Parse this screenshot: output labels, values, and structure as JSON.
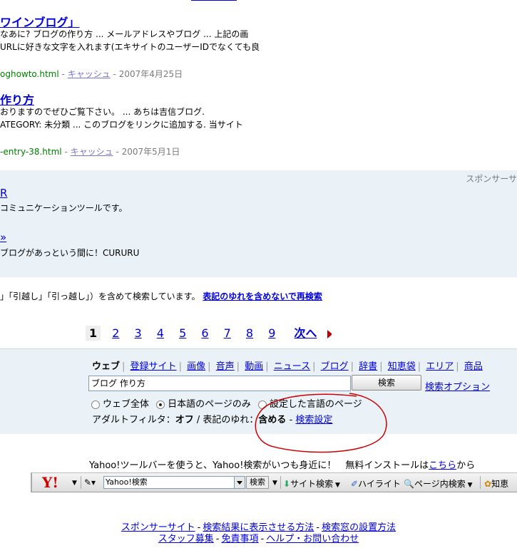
{
  "results": [
    {
      "title": "ワインブログ」",
      "snippet1": "なあに? ブログの作り方 ... メールアドレスやブログ ... 上記の画",
      "snippet2": "URLに好きな文字を入れます(エキサイトのユーザーIDでなくても良",
      "url": "oghowto.html",
      "cache": "キャッシュ",
      "date": "2007年4月25日"
    },
    {
      "title": "作り方",
      "snippet1": "おりますのでぜひご覧下さい。 ... あちは吉信ブログ.",
      "snippet2": "ATEGORY: 未分類 ... このブログをリンクに追加する. 当サイト",
      "url": "-entry-38.html",
      "cache": "キャッシュ",
      "date": "2007年5月1日"
    }
  ],
  "sponsor": {
    "label": "スポンサーサ",
    "ad1_title": "R",
    "ad1_desc": "コミュニケーションツールです。",
    "ad2_title": "»",
    "ad2_desc": "ブログがあっという間に！CURURU"
  },
  "notice": {
    "text": "」「引越し」「引っ越し」）を含めて検索しています。",
    "link": "表記のゆれを含めないで再検索"
  },
  "pager": {
    "current": "1",
    "pages": [
      "2",
      "3",
      "4",
      "5",
      "6",
      "7",
      "8",
      "9"
    ],
    "next": "次へ"
  },
  "search": {
    "tabs": [
      "ウェブ",
      "登録サイト",
      "画像",
      "音声",
      "動画",
      "ニュース",
      "ブログ",
      "辞書",
      "知恵袋",
      "エリア",
      "商品"
    ],
    "query": "ブログ 作り方",
    "button": "検索",
    "options_link": "検索オプション",
    "radios": [
      {
        "label": "ウェブ全体",
        "checked": false
      },
      {
        "label": "日本語のページのみ",
        "checked": true
      },
      {
        "label": "設定した言語のページ",
        "checked": false
      }
    ],
    "adult_filter_label": "アダルトフィルタ：",
    "adult_filter_value": "オフ",
    "yure_label": " / 表記のゆれ：",
    "yure_value": "含める",
    "settings_link": "検索設定"
  },
  "promo": {
    "text": "Yahoo!ツールバーを使うと、Yahoo!検索がいつも身近に！　無料インストールは",
    "link": "こちら",
    "suffix": "から"
  },
  "toolbar": {
    "logo": "Y!",
    "input_value": "Yahoo!検索",
    "search_btn": "検索",
    "site_search": "サイト検索",
    "highlight": "ハイライト",
    "page_search": "ページ内検索",
    "chiebukuro": "知恵"
  },
  "footer": {
    "line1": [
      "スポンサーサイト",
      "検索結果に表示させる方法",
      "検索窓の設置方法"
    ],
    "line2": [
      "スタッフ募集",
      "免責事項",
      "ヘルプ・お問い合わせ"
    ]
  },
  "colors": {
    "link": "#0000de",
    "url_green": "#008000",
    "panel_bg": "#eaf2f8",
    "annotation_red": "#cc0000"
  }
}
